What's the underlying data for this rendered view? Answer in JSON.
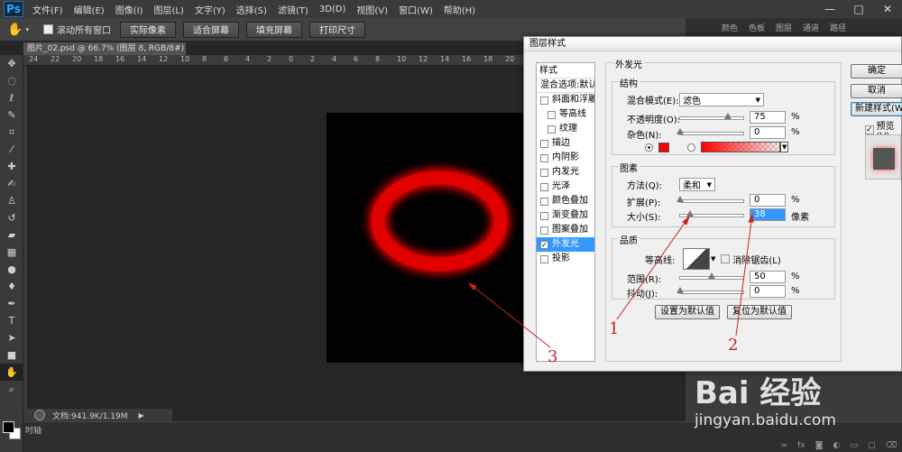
{
  "app": {
    "logo": "Ps"
  },
  "menubar": {
    "items": [
      "文件(F)",
      "编辑(E)",
      "图像(I)",
      "图层(L)",
      "文字(Y)",
      "选择(S)",
      "滤镜(T)",
      "3D(D)",
      "视图(V)",
      "窗口(W)",
      "帮助(H)"
    ],
    "window_controls": [
      "—",
      "□",
      "✕"
    ]
  },
  "options_bar": {
    "scroll_all_windows": "滚动所有窗口",
    "buttons": [
      "实际像素",
      "适合屏幕",
      "填充屏幕",
      "打印尺寸"
    ]
  },
  "document": {
    "tab_title": "图片_02.psd @ 66.7% (图层 8, RGB/8#) *"
  },
  "ruler": {
    "ticks": [
      "24",
      "22",
      "20",
      "18",
      "16",
      "14",
      "12",
      "10",
      "8",
      "6",
      "4",
      "2",
      "0",
      "2",
      "4",
      "6",
      "8",
      "10",
      "12",
      "14",
      "16",
      "18",
      "20"
    ]
  },
  "status": {
    "doc_size": "文档:941.9K/1.19M",
    "bottom_tab": "时轴"
  },
  "right_panel": {
    "tabs": [
      "颜色",
      "色板",
      "图层",
      "通道",
      "路径"
    ]
  },
  "colors": {
    "glow": "#ff1a1a",
    "ring": "#e00000",
    "select_blue": "#3399ff",
    "annotation": "#cc2222"
  },
  "dialog": {
    "title": "图层样式",
    "style_list": {
      "header": "样式",
      "blend_default": "混合选项:默认",
      "items": [
        {
          "label": "斜面和浮雕",
          "checked": false,
          "sub": false
        },
        {
          "label": "等高线",
          "checked": false,
          "sub": true
        },
        {
          "label": "纹理",
          "checked": false,
          "sub": true
        },
        {
          "label": "描边",
          "checked": false,
          "sub": false
        },
        {
          "label": "内阴影",
          "checked": false,
          "sub": false
        },
        {
          "label": "内发光",
          "checked": false,
          "sub": false
        },
        {
          "label": "光泽",
          "checked": false,
          "sub": false
        },
        {
          "label": "颜色叠加",
          "checked": false,
          "sub": false
        },
        {
          "label": "渐变叠加",
          "checked": false,
          "sub": false
        },
        {
          "label": "图案叠加",
          "checked": false,
          "sub": false
        },
        {
          "label": "外发光",
          "checked": true,
          "sub": false,
          "selected": true
        },
        {
          "label": "投影",
          "checked": false,
          "sub": false
        }
      ]
    },
    "outer_glow": {
      "title": "外发光",
      "structure": {
        "title": "结构",
        "blend_mode_label": "混合模式(E):",
        "blend_mode_value": "滤色",
        "opacity_label": "不透明度(O):",
        "opacity_value": "75",
        "opacity_unit": "%",
        "opacity_level": 0.75,
        "noise_label": "杂色(N):",
        "noise_value": "0",
        "noise_unit": "%",
        "noise_level": 0
      },
      "elements": {
        "title": "图素",
        "technique_label": "方法(Q):",
        "technique_value": "柔和",
        "spread_label": "扩展(P):",
        "spread_value": "0",
        "spread_unit": "%",
        "spread_level": 0,
        "size_label": "大小(S):",
        "size_value": "38",
        "size_unit": "像素",
        "size_level": 0.15
      },
      "quality": {
        "title": "品质",
        "contour_label": "等高线:",
        "anti_alias_label": "消除锯齿(L)",
        "range_label": "范围(R):",
        "range_value": "50",
        "range_unit": "%",
        "range_level": 0.5,
        "jitter_label": "抖动(J):",
        "jitter_value": "0",
        "jitter_unit": "%",
        "jitter_level": 0
      },
      "make_default": "设置为默认值",
      "reset_default": "复位为默认值"
    },
    "buttons": {
      "ok": "确定",
      "cancel": "取消",
      "new_style": "新建样式(W)...",
      "preview": "预览(V)"
    }
  },
  "annotations": {
    "one": "1",
    "two": "2",
    "three": "3"
  },
  "watermark": {
    "logo": "Bai 经验",
    "url": "jingyan.baidu.com"
  }
}
